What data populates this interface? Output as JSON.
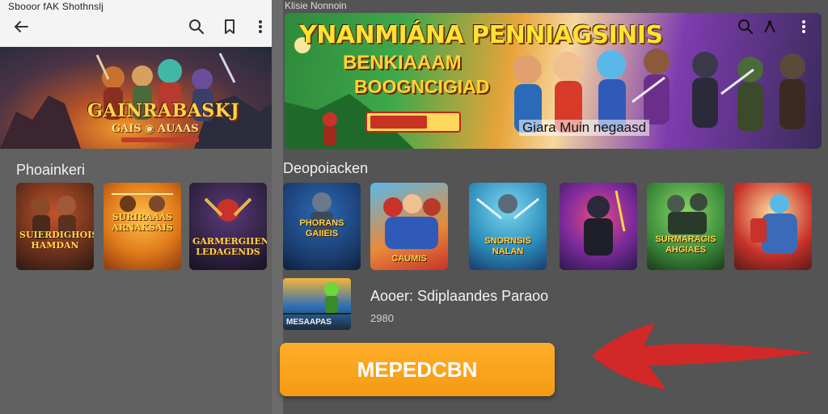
{
  "left_pane": {
    "status_text": "Sbooor fAK Shothnslj",
    "icons": [
      "back-arrow-icon",
      "search-icon",
      "bookmark-icon",
      "more-vert-icon"
    ],
    "banner": {
      "title": "GAINRABASKJ",
      "subtitle": "GAIS ◉ AUAAS"
    },
    "section_title": "Phoainkeri",
    "thumbnails": [
      {
        "label": "SUIERDIGHOIS HAMDAN"
      },
      {
        "label": "SURIRAAAS ARNAKSAIS"
      },
      {
        "label": "GARMERGIIENG LEDAGENDS"
      }
    ]
  },
  "right_pane": {
    "status_text": "Klisie Nonnoin",
    "icons": [
      "search-icon",
      "share-icon",
      "more-vert-icon"
    ],
    "hero": {
      "title": "YNANMIÁNA PENNIAGSINIS",
      "subtitle1": "BENKIAAAM",
      "subtitle2": "BOOGNCIGIAD",
      "caption": "Giara Muin negaasd"
    },
    "section_title": "Deopoiacken",
    "games": [
      {
        "label": "PHORANS GAIIEIS"
      },
      {
        "label": "CAUMIS"
      },
      {
        "label": "SNORNSIS NALAN"
      },
      {
        "label": ""
      },
      {
        "label": "SURMARAGIS AHGIAES"
      },
      {
        "label": ""
      }
    ],
    "app_row": {
      "thumb_label": "MESAAPAS",
      "name": "Aooer: Sdiplaandes Paraoo",
      "meta": "2980"
    },
    "cta_label": "MEPEDCBN"
  },
  "colors": {
    "cta": "#f5a623",
    "title_gold": "#ffd447",
    "arrow": "#e02424"
  }
}
